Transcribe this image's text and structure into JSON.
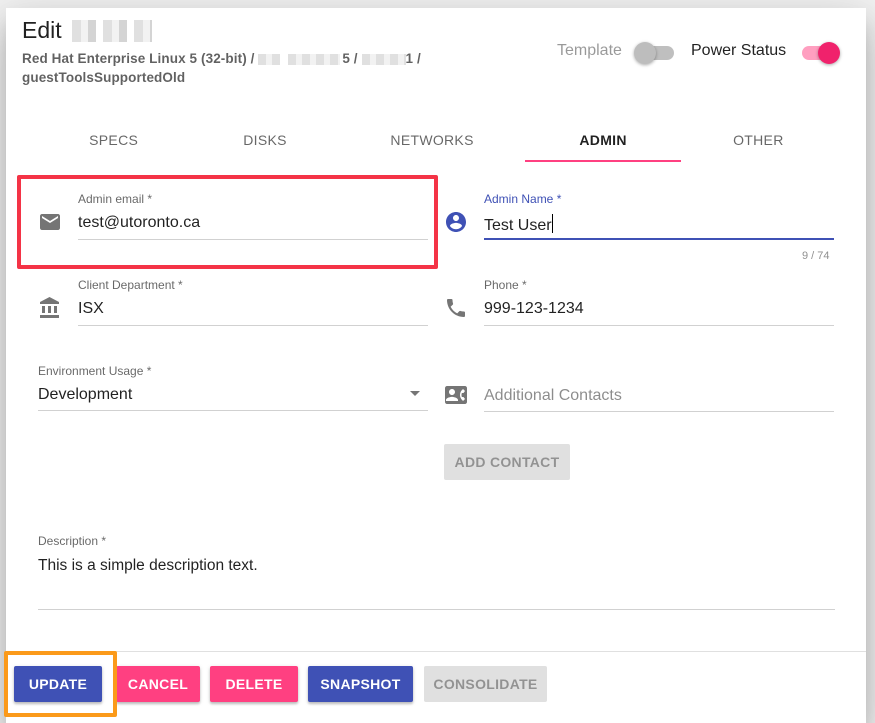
{
  "dialog": {
    "title": "Edit",
    "subtitle": {
      "line1_prefix": "Red Hat Enterprise Linux 5 (32-bit) / ",
      "sep1": "5 / ",
      "sep2": "1 / ",
      "line2": "guestToolsSupportedOld"
    }
  },
  "toggles": {
    "template": {
      "label": "Template",
      "on": false
    },
    "power": {
      "label": "Power Status",
      "on": true
    }
  },
  "tabs": [
    {
      "label": "SPECS"
    },
    {
      "label": "DISKS"
    },
    {
      "label": "NETWORKS"
    },
    {
      "label": "ADMIN"
    },
    {
      "label": "OTHER"
    }
  ],
  "fields": {
    "admin_email": {
      "label": "Admin email *",
      "value": "test@utoronto.ca",
      "icon": "email-icon"
    },
    "admin_name": {
      "label": "Admin Name *",
      "value": "Test User",
      "counter": "9 / 74",
      "icon": "account-circle-icon"
    },
    "client_department": {
      "label": "Client Department *",
      "value": "ISX",
      "icon": "bank-icon"
    },
    "phone": {
      "label": "Phone *",
      "value": "999-123-1234",
      "icon": "phone-icon"
    },
    "environment_usage": {
      "label": "Environment Usage *",
      "value": "Development",
      "icon": "dropdown-arrow-icon"
    },
    "additional_contacts": {
      "placeholder": "Additional Contacts",
      "icon": "contact-card-icon"
    },
    "description": {
      "label": "Description *",
      "value": "This is a simple description text."
    }
  },
  "buttons": {
    "add_contact": "ADD CONTACT",
    "update": "UPDATE",
    "cancel": "CANCEL",
    "delete": "DELETE",
    "snapshot": "SNAPSHOT",
    "consolidate": "CONSOLIDATE"
  },
  "colors": {
    "primary": "#3f51b5",
    "accent": "#ff4081",
    "annotation_red": "#f43346",
    "annotation_orange": "#fb9a1a",
    "disabled": "#e0e0e0"
  }
}
